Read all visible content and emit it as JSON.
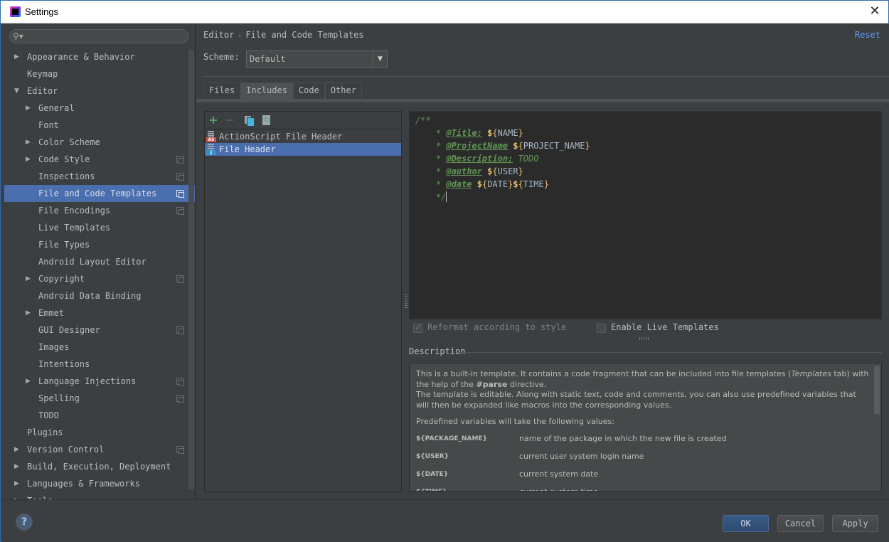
{
  "window": {
    "title": "Settings",
    "close_glyph": "✕"
  },
  "sidebar": {
    "search": {
      "value": "",
      "placeholder": "",
      "icon": "search-icon"
    },
    "items": [
      {
        "label": "Appearance & Behavior",
        "level": 0,
        "arrow": "▶",
        "project": false,
        "selected": false
      },
      {
        "label": "Keymap",
        "level": 0,
        "arrow": "",
        "project": false,
        "selected": false
      },
      {
        "label": "Editor",
        "level": 0,
        "arrow": "▼",
        "project": false,
        "selected": false
      },
      {
        "label": "General",
        "level": 1,
        "arrow": "▶",
        "project": false,
        "selected": false
      },
      {
        "label": "Font",
        "level": 1,
        "arrow": "",
        "project": false,
        "selected": false
      },
      {
        "label": "Color Scheme",
        "level": 1,
        "arrow": "▶",
        "project": false,
        "selected": false
      },
      {
        "label": "Code Style",
        "level": 1,
        "arrow": "▶",
        "project": true,
        "selected": false
      },
      {
        "label": "Inspections",
        "level": 1,
        "arrow": "",
        "project": true,
        "selected": false
      },
      {
        "label": "File and Code Templates",
        "level": 1,
        "arrow": "",
        "project": true,
        "selected": true
      },
      {
        "label": "File Encodings",
        "level": 1,
        "arrow": "",
        "project": true,
        "selected": false
      },
      {
        "label": "Live Templates",
        "level": 1,
        "arrow": "",
        "project": false,
        "selected": false
      },
      {
        "label": "File Types",
        "level": 1,
        "arrow": "",
        "project": false,
        "selected": false
      },
      {
        "label": "Android Layout Editor",
        "level": 1,
        "arrow": "",
        "project": false,
        "selected": false
      },
      {
        "label": "Copyright",
        "level": 1,
        "arrow": "▶",
        "project": true,
        "selected": false
      },
      {
        "label": "Android Data Binding",
        "level": 1,
        "arrow": "",
        "project": false,
        "selected": false
      },
      {
        "label": "Emmet",
        "level": 1,
        "arrow": "▶",
        "project": false,
        "selected": false
      },
      {
        "label": "GUI Designer",
        "level": 1,
        "arrow": "",
        "project": true,
        "selected": false
      },
      {
        "label": "Images",
        "level": 1,
        "arrow": "",
        "project": false,
        "selected": false
      },
      {
        "label": "Intentions",
        "level": 1,
        "arrow": "",
        "project": false,
        "selected": false
      },
      {
        "label": "Language Injections",
        "level": 1,
        "arrow": "▶",
        "project": true,
        "selected": false
      },
      {
        "label": "Spelling",
        "level": 1,
        "arrow": "",
        "project": true,
        "selected": false
      },
      {
        "label": "TODO",
        "level": 1,
        "arrow": "",
        "project": false,
        "selected": false
      },
      {
        "label": "Plugins",
        "level": 0,
        "arrow": "",
        "project": false,
        "selected": false
      },
      {
        "label": "Version Control",
        "level": 0,
        "arrow": "▶",
        "project": true,
        "selected": false
      },
      {
        "label": "Build, Execution, Deployment",
        "level": 0,
        "arrow": "▶",
        "project": false,
        "selected": false
      },
      {
        "label": "Languages & Frameworks",
        "level": 0,
        "arrow": "▶",
        "project": false,
        "selected": false
      },
      {
        "label": "Tools",
        "level": 0,
        "arrow": "▶",
        "project": false,
        "selected": false
      }
    ]
  },
  "main": {
    "breadcrumb": {
      "parent": "Editor",
      "separator": "›",
      "current": "File and Code Templates"
    },
    "reset_label": "Reset",
    "scheme": {
      "label": "Scheme:",
      "value": "Default",
      "dropdown_glyph": "▼"
    },
    "tabs": [
      {
        "label": "Files",
        "active": false
      },
      {
        "label": "Includes",
        "active": true
      },
      {
        "label": "Code",
        "active": false
      },
      {
        "label": "Other",
        "active": false
      }
    ],
    "list_toolbar": {
      "add": "+",
      "remove": "−"
    },
    "templates": [
      {
        "label": "ActionScript File Header",
        "badge": "AS",
        "badge_color": "#c75450",
        "selected": false
      },
      {
        "label": "File Header",
        "badge": "J",
        "badge_color": "#3592c4",
        "selected": true
      }
    ],
    "editor": {
      "lines": [
        {
          "type": "open",
          "text": "/**"
        },
        {
          "type": "tag",
          "star": "* ",
          "tag": "@Title:",
          "var": "NAME"
        },
        {
          "type": "tag",
          "star": "* ",
          "tag": "@ProjectName",
          "var": "PROJECT_NAME"
        },
        {
          "type": "todo",
          "star": "* ",
          "tag": "@Description:",
          "text": "TODO"
        },
        {
          "type": "tag",
          "star": "* ",
          "tag": "@author",
          "var": "USER"
        },
        {
          "type": "tag2",
          "star": "* ",
          "tag": "@date",
          "var": "DATE",
          "var2": "TIME"
        },
        {
          "type": "close",
          "text": "*/"
        }
      ]
    },
    "options": {
      "reformat": {
        "label": "Reformat according to style",
        "checked": true,
        "disabled": true
      },
      "live_templates": {
        "label": "Enable Live Templates",
        "checked": false
      }
    },
    "description": {
      "title": "Description",
      "p1_a": "This is a built-in template. It contains a code fragment that can be included into file templates (",
      "p1_italic": "Templates",
      "p1_b": " tab) with the help of the ",
      "p1_bold": "#parse",
      "p1_c": " directive.",
      "p1_d": "The template is editable. Along with static text, code and comments, you can also use predefined variables that will then be expanded like macros into the corresponding values.",
      "p2": "Predefined variables will take the following values:",
      "variables": [
        {
          "name": "${PACKAGE_NAME}",
          "desc": "name of the package in which the new file is created"
        },
        {
          "name": "${USER}",
          "desc": "current user system login name"
        },
        {
          "name": "${DATE}",
          "desc": "current system date"
        },
        {
          "name": "${TIME}",
          "desc": "current system time"
        }
      ]
    }
  },
  "footer": {
    "help": "?",
    "ok": "OK",
    "cancel": "Cancel",
    "apply": "Apply"
  }
}
